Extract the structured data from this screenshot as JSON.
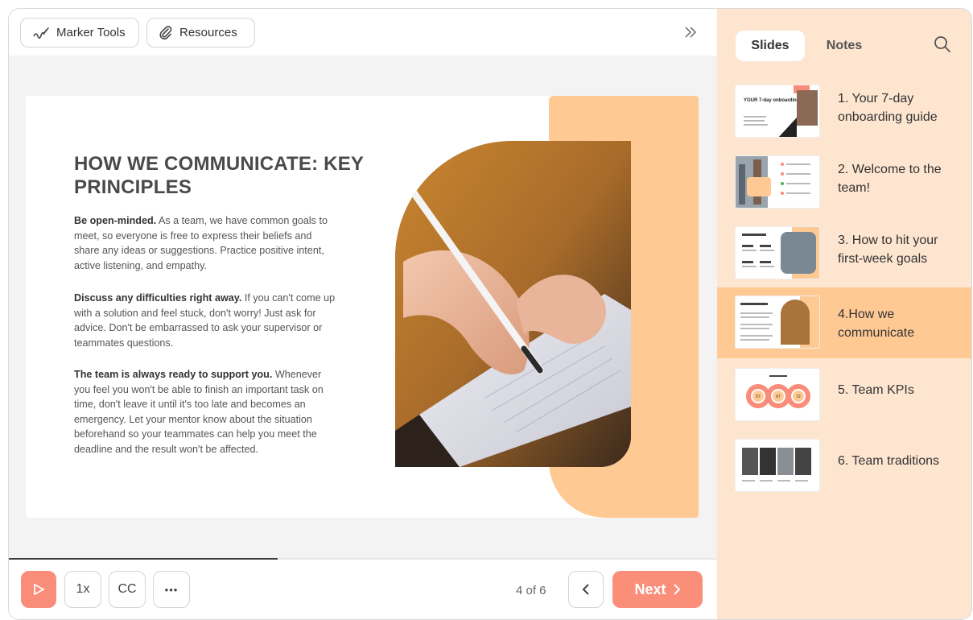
{
  "toolbar": {
    "marker_tools_label": "Marker Tools",
    "resources_label": "Resources"
  },
  "slide": {
    "title": "HOW WE COMMUNICATE: KEY PRINCIPLES",
    "paragraphs": [
      {
        "bold": "Be open-minded.",
        "text": " As a team, we have common goals to meet, so everyone is free to express their beliefs and share any ideas or suggestions. Practice positive intent, active listening, and empathy."
      },
      {
        "bold": "Discuss any difficulties right away.",
        "text": " If you can't come up with a solution and feel stuck, don't worry! Just ask for advice. Don't be embarrassed to ask your supervisor or teammates questions."
      },
      {
        "bold": "The team is always ready to support you.",
        "text": " Whenever you feel you won't be able to finish an important task on time, don't leave it until it's too late and becomes an emergency. Let your mentor know about the situation beforehand so your teammates can help you meet the deadline and the result won't be affected."
      }
    ]
  },
  "player": {
    "speed_label": "1x",
    "cc_label": "CC",
    "more_label": "•••",
    "page_indicator": "4 of 6",
    "next_label": "Next",
    "progress": 0.38
  },
  "sidebar": {
    "tabs": [
      {
        "label": "Slides",
        "active": true
      },
      {
        "label": "Notes",
        "active": false
      }
    ],
    "slides": [
      {
        "label": "1. Your 7-day onboarding guide",
        "thumb_title": "YOUR 7-day onboarding guide",
        "active": false
      },
      {
        "label": "2. Welcome to the team!",
        "active": false
      },
      {
        "label": "3. How to hit your first-week goals",
        "active": false
      },
      {
        "label": "4.How we communicate",
        "active": true
      },
      {
        "label": "5. Team KPIs",
        "kpis": [
          "57",
          "67",
          "72"
        ],
        "active": false
      },
      {
        "label": "6. Team traditions",
        "active": false
      }
    ]
  },
  "colors": {
    "accent": "#fa8e78",
    "peach": "#ffc994",
    "sidebar_bg": "#fde5d0",
    "active_row": "#ffc994"
  }
}
